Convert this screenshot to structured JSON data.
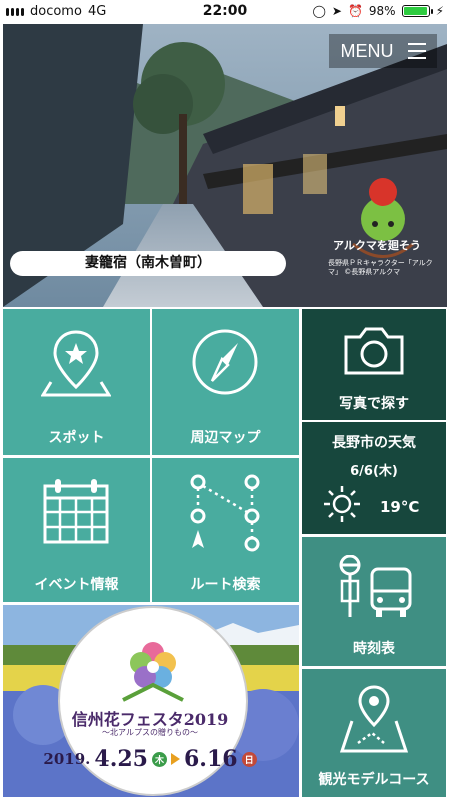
{
  "status_bar": {
    "carrier": "docomo",
    "network": "4G",
    "time": "22:00",
    "battery": "98%",
    "battery_level": 0.98
  },
  "hero": {
    "menu_label": "MENU",
    "caption": "妻籠宿（南木曽町）",
    "mascot_cta": "アルクマを廻そう",
    "mascot_credit": "長野県ＰＲキャラクター「アルクマ」 ©長野県アルクマ"
  },
  "tiles": {
    "spot": "スポット",
    "map": "周辺マップ",
    "photo_search": "写真で探す",
    "event": "イベント情報",
    "route": "ルート検索",
    "timetable": "時刻表",
    "course": "観光モデルコース"
  },
  "weather": {
    "title": "長野市の天気",
    "date": "6/6(木)",
    "temperature": "19°C",
    "condition_icon": "sun-icon"
  },
  "banner": {
    "name": "信州花フェスタ2019",
    "subtitle": "〜北アルプスの贈りもの〜",
    "year": "2019.",
    "start": "4.25",
    "start_day": "木",
    "end": "6.16",
    "end_day": "日"
  },
  "colors": {
    "tile_teal": "#49ac9f",
    "tile_dark": "#17473d",
    "tile_mid": "#3f8f83"
  }
}
